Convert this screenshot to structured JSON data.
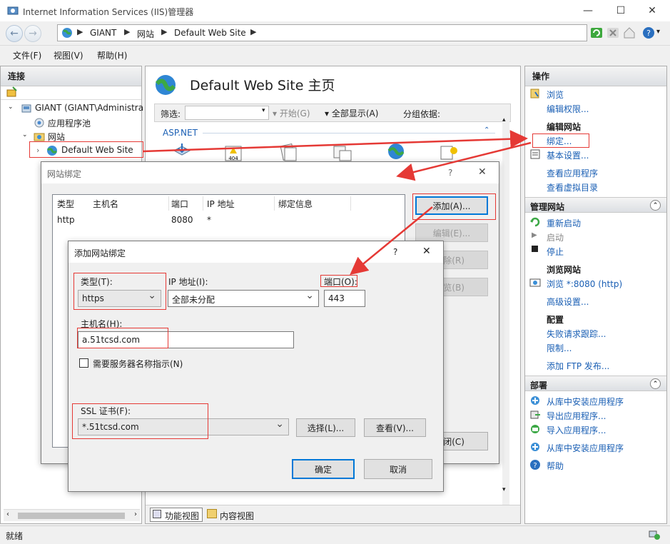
{
  "window": {
    "title": "Internet Information Services (IIS)管理器"
  },
  "address": {
    "segments": [
      "GIANT",
      "网站",
      "Default Web Site"
    ]
  },
  "menu": [
    "文件(F)",
    "视图(V)",
    "帮助(H)"
  ],
  "left": {
    "header": "连接",
    "tree": [
      "GIANT (GIANT\\Administra",
      "应用程序池",
      "网站",
      "Default Web Site"
    ]
  },
  "center": {
    "title": "Default Web Site 主页",
    "filter_label": "筛选:",
    "start_label": "开始(G)",
    "showall_label": "全部显示(A)",
    "groupby_label": "分组依据:",
    "group_aspnet": "ASP.NET",
    "tab_features": "功能视图",
    "tab_content": "内容视图"
  },
  "right": {
    "header": "操作",
    "browse": "浏览",
    "edit_perms": "编辑权限...",
    "edit_site_head": "编辑网站",
    "bindings": "绑定...",
    "basic_settings": "基本设置...",
    "view_apps": "查看应用程序",
    "view_vdirs": "查看虚拟目录",
    "manage_head": "管理网站",
    "restart": "重新启动",
    "start": "启动",
    "stop": "停止",
    "browse_site_head": "浏览网站",
    "browse_port": "浏览 *:8080 (http)",
    "advanced": "高级设置...",
    "config_head": "配置",
    "failed_req": "失败请求跟踪...",
    "limits": "限制...",
    "add_ftp": "添加 FTP 发布...",
    "deploy_head": "部署",
    "install_gallery": "从库中安装应用程序",
    "export_app": "导出应用程序...",
    "import_app": "导入应用程序...",
    "install_gallery2": "从库中安装应用程序",
    "help": "帮助"
  },
  "status": {
    "text": "就绪"
  },
  "bindings_dialog": {
    "title": "网站绑定",
    "columns": [
      "类型",
      "主机名",
      "端口",
      "IP 地址",
      "绑定信息"
    ],
    "rows": [
      {
        "type": "http",
        "host": "",
        "port": "8080",
        "ip": "*",
        "info": ""
      }
    ],
    "add": "添加(A)...",
    "edit": "编辑(E)...",
    "remove": "除(R)",
    "browse": "览(B)",
    "close": "闭(C)"
  },
  "add_dialog": {
    "title": "添加网站绑定",
    "type_label": "类型(T):",
    "type_value": "https",
    "ip_label": "IP 地址(I):",
    "ip_value": "全部未分配",
    "port_label": "端口(O):",
    "port_value": "443",
    "host_label": "主机名(H):",
    "host_value": "a.51tcsd.com",
    "sni_label": "需要服务器名称指示(N)",
    "ssl_label": "SSL 证书(F):",
    "ssl_value": "*.51tcsd.com",
    "select_btn": "选择(L)...",
    "view_btn": "查看(V)...",
    "ok": "确定",
    "cancel": "取消"
  },
  "colors": {
    "annotation_red": "#e53935",
    "link_blue": "#1a5fb4"
  }
}
